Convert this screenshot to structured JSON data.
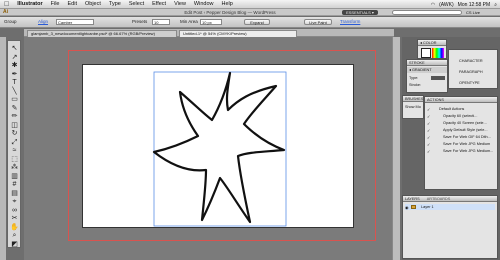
{
  "menubar": {
    "apple": "",
    "items": [
      "Illustrator",
      "File",
      "Edit",
      "Object",
      "Type",
      "Select",
      "Effect",
      "View",
      "Window",
      "Help"
    ],
    "right": {
      "battery": "(AWK)",
      "time": "Mon 12:58 PM"
    }
  },
  "browser": {
    "title": "Edit Post ‹ Pepper Design Blog — WordPress",
    "workspace": "ESSENTIALS ▾",
    "cs_live": "CS Live"
  },
  "control_bar": {
    "selection": "Group",
    "align_link": "Align",
    "brush_value": "Camber",
    "presets_label": "Presets",
    "presets_value": "10",
    "min_area_label": "Min Area",
    "min_area_value": "10 px",
    "expand_button": "Expand",
    "live_paint_button": "Live Paint",
    "transform_link": "Transform"
  },
  "doc_tabs": [
    {
      "label": "glamjamb_3_newdocumentlightcanbe.psd* @ 66.67% (RGB/Preview)"
    },
    {
      "label": "Untitled-1* @ 54% (CMYK/Preview)"
    }
  ],
  "tools": [
    {
      "icon": "selection-tool-icon",
      "glyph": "↖"
    },
    {
      "icon": "direct-selection-tool-icon",
      "glyph": "↗"
    },
    {
      "icon": "magic-wand-tool-icon",
      "glyph": "✱"
    },
    {
      "icon": "pen-tool-icon",
      "glyph": "✒"
    },
    {
      "icon": "type-tool-icon",
      "glyph": "T"
    },
    {
      "icon": "line-tool-icon",
      "glyph": "╲"
    },
    {
      "icon": "rectangle-tool-icon",
      "glyph": "▭"
    },
    {
      "icon": "paintbrush-tool-icon",
      "glyph": "✎"
    },
    {
      "icon": "pencil-tool-icon",
      "glyph": "✏"
    },
    {
      "icon": "eraser-tool-icon",
      "glyph": "◫"
    },
    {
      "icon": "rotate-tool-icon",
      "glyph": "↻"
    },
    {
      "icon": "scale-tool-icon",
      "glyph": "⤢"
    },
    {
      "icon": "warp-tool-icon",
      "glyph": "≈"
    },
    {
      "icon": "free-transform-tool-icon",
      "glyph": "⬚"
    },
    {
      "icon": "symbol-sprayer-tool-icon",
      "glyph": "⁂"
    },
    {
      "icon": "graph-tool-icon",
      "glyph": "▥"
    },
    {
      "icon": "mesh-tool-icon",
      "glyph": "#"
    },
    {
      "icon": "gradient-tool-icon",
      "glyph": "▤"
    },
    {
      "icon": "eyedropper-tool-icon",
      "glyph": "⌖"
    },
    {
      "icon": "blend-tool-icon",
      "glyph": "∞"
    },
    {
      "icon": "scissors-tool-icon",
      "glyph": "✂"
    },
    {
      "icon": "hand-tool-icon",
      "glyph": "✋"
    },
    {
      "icon": "zoom-tool-icon",
      "glyph": "⌕"
    },
    {
      "icon": "fill-stroke-icon",
      "glyph": "◩"
    }
  ],
  "panels": {
    "color": {
      "title": "◂ COLOR"
    },
    "stroke": {
      "title": "STROKE",
      "gradient": "◂ GRADIENT",
      "type_label": "Type:",
      "stroke_label": "Stroke:"
    },
    "type": {
      "items": [
        "CHARACTER",
        "PARAGRAPH",
        "OPENTYPE"
      ]
    },
    "brushes": {
      "title": "BRUSHES",
      "show_label": "Show Modes"
    },
    "actions": {
      "title": "ACTIONS",
      "items": [
        "Default Actions",
        "Opacity 60 (selecti...",
        "Opacity 40 Screen (sele...",
        "Apply Default Style (sele...",
        "Save For Web GIF 64 Dith...",
        "Save For Web JPG Medium",
        "Save For Web JPG Medium..."
      ]
    },
    "layers": {
      "title": "LAYERS",
      "tab2": "ARTBOARDS",
      "items": [
        "Layer 1"
      ]
    }
  }
}
